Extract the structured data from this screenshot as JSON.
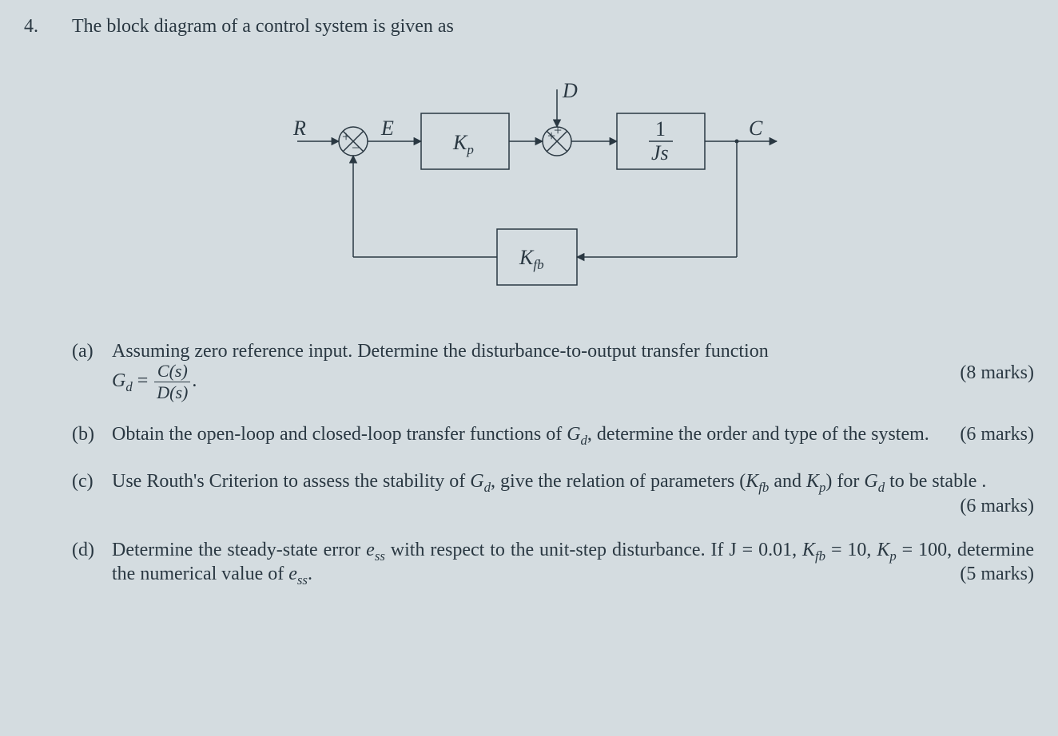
{
  "question": {
    "number": "4.",
    "text": "The block diagram of a control system is given as"
  },
  "diagram": {
    "R": "R",
    "E": "E",
    "D": "D",
    "C": "C",
    "Kp": "K",
    "Kp_sub": "p",
    "Kfb": "K",
    "Kfb_sub": "fb",
    "plant_num": "1",
    "plant_den": "Js"
  },
  "parts": {
    "a": {
      "label": "(a)",
      "text1": "Assuming zero reference input. Determine the disturbance-to-output transfer function",
      "gd": "G",
      "gd_sub": "d",
      "eq": " = ",
      "frac_num": "C(s)",
      "frac_den": "D(s)",
      "period": ".",
      "marks": "(8 marks)"
    },
    "b": {
      "label": "(b)",
      "text1": "Obtain the open-loop and closed-loop transfer functions of ",
      "gd": "G",
      "gd_sub": "d",
      "text2": ", determine the order and type of the system.",
      "marks": "(6 marks)"
    },
    "c": {
      "label": "(c)",
      "text1": "Use Routh's Criterion to assess the stability of ",
      "gd": "G",
      "gd_sub": "d",
      "text2": ", give the relation of parameters (",
      "kfb": "K",
      "kfb_sub": "fb",
      "text3": " and ",
      "kp": "K",
      "kp_sub": "p",
      "text4": ") for ",
      "gd2": "G",
      "gd2_sub": "d",
      "text5": " to be stable .",
      "marks": "(6 marks)"
    },
    "d": {
      "label": "(d)",
      "text1": "Determine  the  steady-state  error ",
      "ess": "e",
      "ess_sub": "ss",
      "text2": " with respect to the unit-step disturbance.  If J = 0.01, ",
      "kfb": "K",
      "kfb_sub": "fb",
      "text3": " = 10, ",
      "kp": "K",
      "kp_sub": "p",
      "text4": " = 100, determine the numerical value of ",
      "ess2": "e",
      "ess2_sub": "ss",
      "text5": ".",
      "marks": "(5 marks)"
    }
  }
}
